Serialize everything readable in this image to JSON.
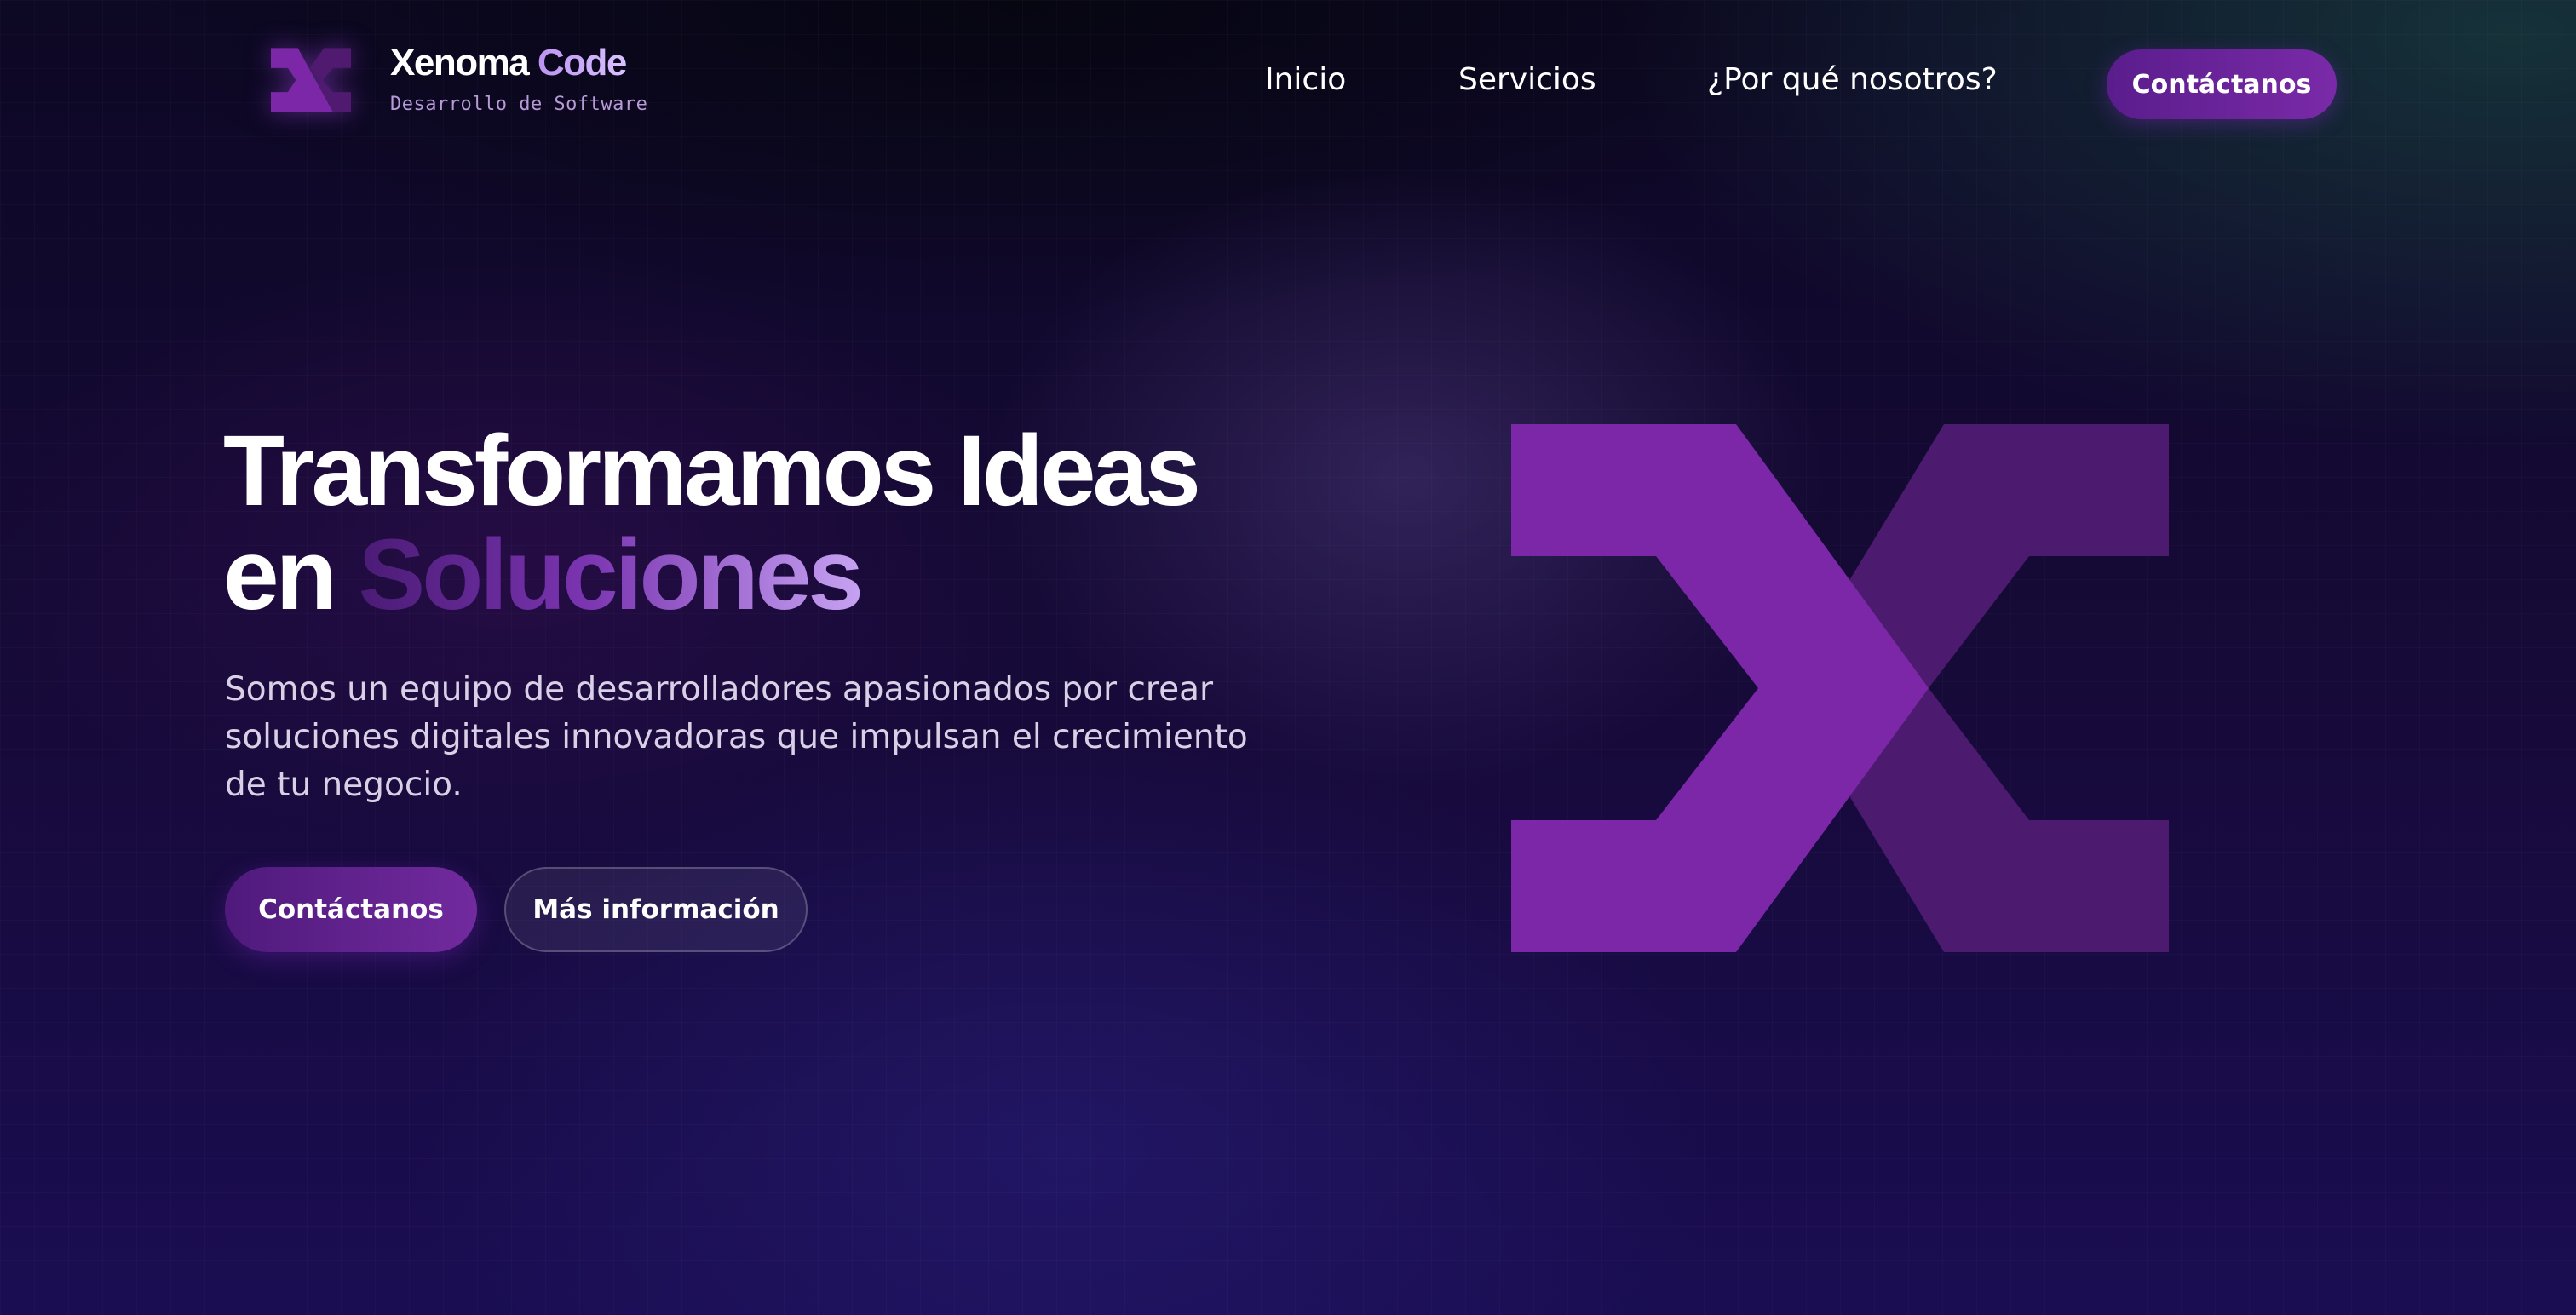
{
  "brand": {
    "name_primary": "Xenoma",
    "name_secondary": " Code",
    "tagline": "Desarrollo de Software",
    "logo_icon": "x-logo-icon"
  },
  "nav": {
    "items": [
      {
        "label": "Inicio"
      },
      {
        "label": "Servicios"
      },
      {
        "label": "¿Por qué nosotros?"
      }
    ],
    "cta_label": "Contáctanos"
  },
  "hero": {
    "title_line1": "Transformamos Ideas",
    "title_line2_prefix": "en ",
    "title_line2_highlight": "Soluciones",
    "description": "Somos un equipo de desarrolladores apasionados por crear soluciones digitales innovadoras que impulsan el crecimiento de tu negocio.",
    "primary_button": "Contáctanos",
    "secondary_button": "Más información",
    "graphic_icon": "x-logo-icon"
  },
  "colors": {
    "accent": "#7b27a8",
    "accent_dark": "#4f1a6f",
    "accent_light": "#c6a2f2",
    "background": "#150935"
  }
}
